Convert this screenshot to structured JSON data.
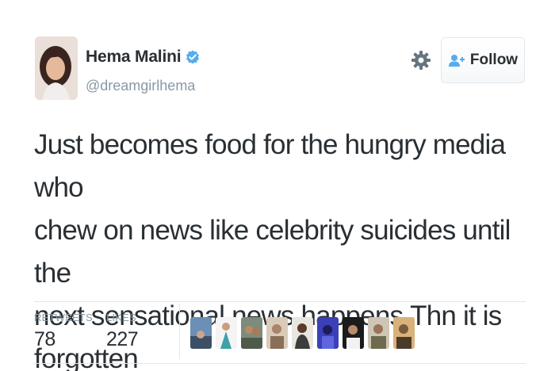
{
  "user": {
    "name": "Hema Malini",
    "handle": "@dreamgirlhema",
    "verified": true
  },
  "actions": {
    "follow_label": "Follow"
  },
  "tweet": {
    "lines": [
      "Just becomes food for the hungry media who",
      "chew on news like celebrity suicides until the",
      "next sensational news happens.Thn it is",
      "forgotten"
    ]
  },
  "stats": {
    "retweets_label": "RETWEETS",
    "retweets_value": "78",
    "likes_label": "LIKES",
    "likes_value": "227"
  },
  "likers": [
    {
      "icon": "user-avatar"
    },
    {
      "icon": "user-avatar"
    },
    {
      "icon": "user-avatar"
    },
    {
      "icon": "user-avatar"
    },
    {
      "icon": "user-avatar"
    },
    {
      "icon": "user-avatar"
    },
    {
      "icon": "user-avatar"
    },
    {
      "icon": "user-avatar"
    },
    {
      "icon": "user-avatar"
    }
  ],
  "colors": {
    "text": "#292f33",
    "muted": "#8899a6",
    "verified": "#55acee",
    "border": "#e1e8ed"
  }
}
